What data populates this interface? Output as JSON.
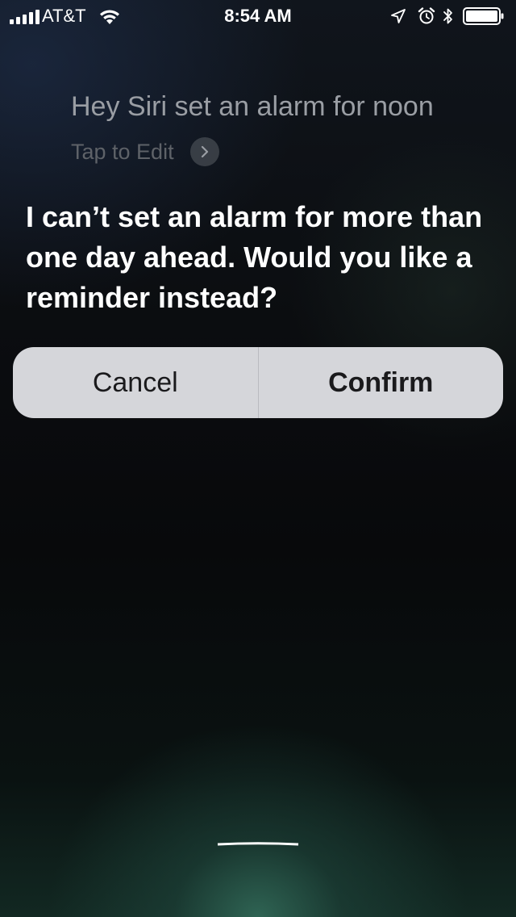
{
  "status_bar": {
    "carrier": "AT&T",
    "time": "8:54 AM",
    "signal_bars": 5,
    "icons": [
      "signal-icon",
      "wifi-icon",
      "location-arrow-icon",
      "alarm-clock-icon",
      "bluetooth-icon",
      "battery-icon"
    ]
  },
  "siri": {
    "query": "Hey Siri set an alarm for noon",
    "tap_to_edit": "Tap to Edit",
    "response": "I can’t set an alarm for more than one day ahead. Would you like a reminder instead?"
  },
  "actions": {
    "cancel_label": "Cancel",
    "confirm_label": "Confirm"
  },
  "colors": {
    "query_text": "#9a9ea4",
    "tap_to_edit_text": "#5e6268",
    "button_background": "#d5d6da",
    "button_text": "#1a1a1c",
    "glow": "#346e5c"
  }
}
